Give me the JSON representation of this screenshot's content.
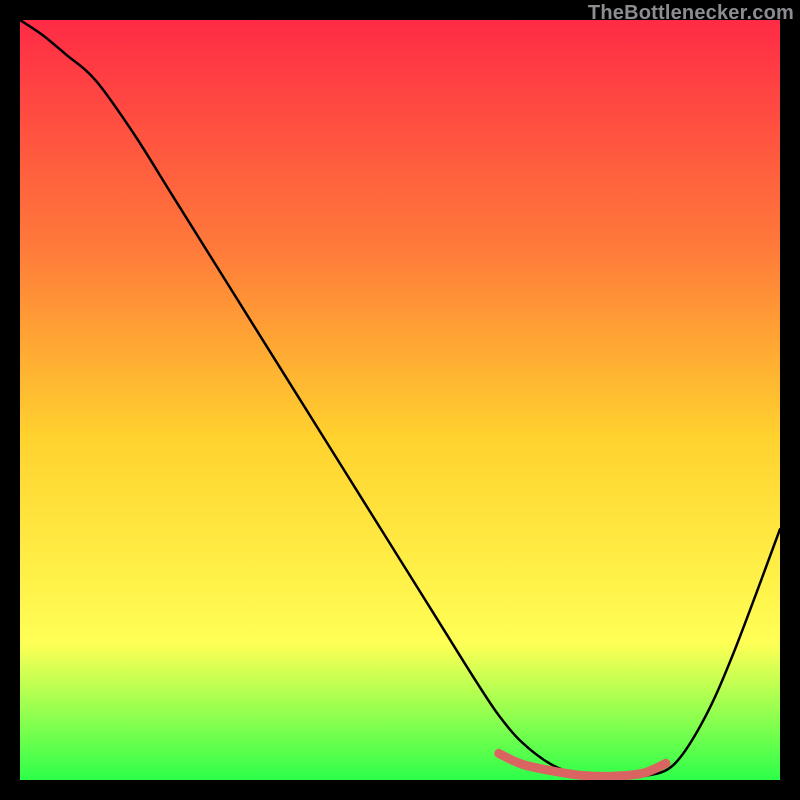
{
  "attribution": "TheBottlenecker.com",
  "colors": {
    "gradient_top": "#ff2b46",
    "gradient_mid1": "#ff7a3a",
    "gradient_mid2": "#ffd22e",
    "gradient_mid3": "#ffff55",
    "gradient_bottom": "#2dff4a",
    "frame": "#000000",
    "curve": "#000000",
    "highlight": "#d96462"
  },
  "chart_data": {
    "type": "line",
    "title": "",
    "xlabel": "",
    "ylabel": "",
    "xlim": [
      0,
      100
    ],
    "ylim": [
      0,
      100
    ],
    "series": [
      {
        "name": "curve",
        "x": [
          0,
          3,
          6,
          10,
          15,
          20,
          25,
          30,
          35,
          40,
          45,
          50,
          55,
          60,
          63,
          66,
          70,
          74,
          78,
          82,
          86,
          90,
          94,
          100
        ],
        "y": [
          100,
          98,
          95.5,
          92,
          85,
          77,
          69,
          61,
          53,
          45,
          37,
          29,
          21,
          13,
          8.5,
          5,
          2,
          0.6,
          0.3,
          0.5,
          2,
          8,
          17,
          33
        ]
      },
      {
        "name": "highlight_segment",
        "x": [
          63,
          66,
          70,
          74,
          78,
          82,
          85
        ],
        "y": [
          3.5,
          2.1,
          1.2,
          0.6,
          0.5,
          0.9,
          2.2
        ]
      }
    ]
  }
}
